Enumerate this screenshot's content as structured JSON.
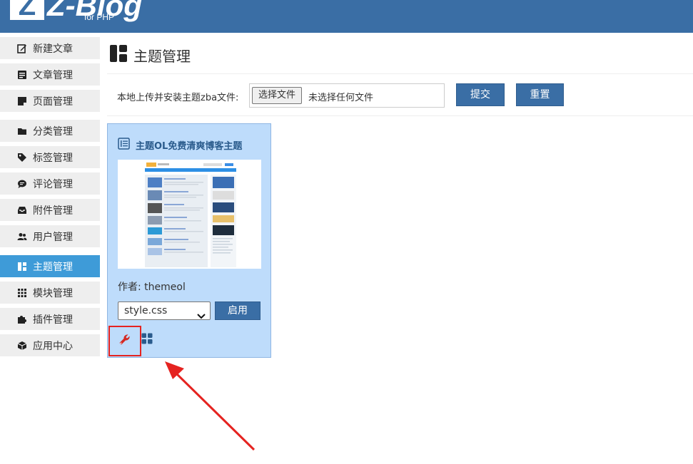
{
  "app": {
    "logo_letter": "Z",
    "logo_text": "Z-Blog",
    "logo_sub": "for PHP"
  },
  "sidebar": {
    "items": [
      {
        "label": "新建文章",
        "icon": "edit-icon",
        "active": false
      },
      {
        "label": "文章管理",
        "icon": "article-icon",
        "active": false
      },
      {
        "label": "页面管理",
        "icon": "page-icon",
        "active": false
      },
      {
        "label": "分类管理",
        "icon": "folder-icon",
        "active": false
      },
      {
        "label": "标签管理",
        "icon": "tag-icon",
        "active": false
      },
      {
        "label": "评论管理",
        "icon": "comment-icon",
        "active": false
      },
      {
        "label": "附件管理",
        "icon": "inbox-icon",
        "active": false
      },
      {
        "label": "用户管理",
        "icon": "users-icon",
        "active": false
      },
      {
        "label": "主题管理",
        "icon": "layout-icon",
        "active": true
      },
      {
        "label": "模块管理",
        "icon": "grid-icon",
        "active": false
      },
      {
        "label": "插件管理",
        "icon": "puzzle-icon",
        "active": false
      },
      {
        "label": "应用中心",
        "icon": "box-icon",
        "active": false
      }
    ]
  },
  "main": {
    "title": "主题管理",
    "upload": {
      "label": "本地上传并安装主题zba文件:",
      "choose_button": "选择文件",
      "file_status": "未选择任何文件",
      "submit_label": "提交",
      "reset_label": "重置"
    },
    "theme": {
      "name": "主题OL免费清爽博客主题",
      "author": "作者: themeol",
      "style_value": "style.css",
      "enable_label": "启用",
      "settings_icon": "wrench-icon",
      "modules_icon": "grid-icon"
    }
  },
  "colors": {
    "header": "#3a6ea5",
    "sidebar_active": "#3e9bd8",
    "card_bg": "#bedcfb",
    "highlight": "#e52320"
  }
}
